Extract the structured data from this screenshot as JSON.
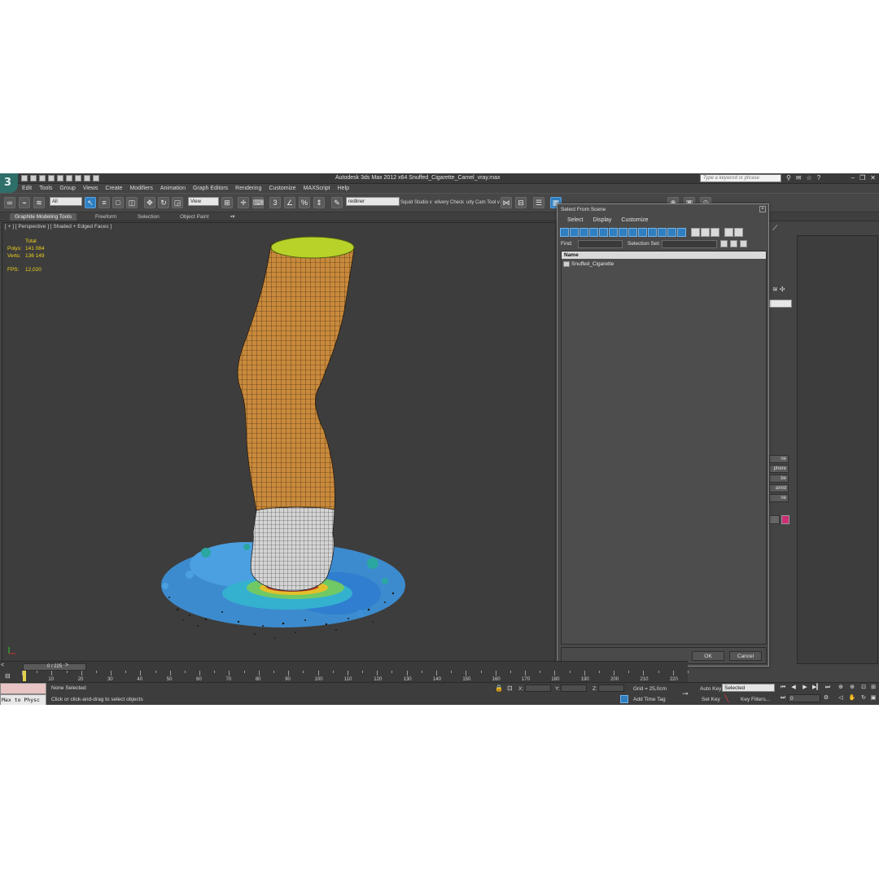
{
  "window": {
    "title": "Autodesk 3ds Max  2012 x64      Snuffed_Cigarette_Camel_vray.max",
    "search_placeholder": "Type a keyword or phrase"
  },
  "menu": [
    "Edit",
    "Tools",
    "Group",
    "Views",
    "Create",
    "Modifiers",
    "Animation",
    "Graph Editors",
    "Rendering",
    "Customize",
    "MAXScript",
    "Help"
  ],
  "toolbar": {
    "filter_value": "All",
    "view_value": "View",
    "named_selection_value": "redliner",
    "extra_labels": [
      "Squid Studio v",
      "elivery Check",
      "uity Cam Tool v"
    ]
  },
  "ribbon": {
    "tabs": [
      "Graphite Modeling Tools",
      "Freeform",
      "Selection",
      "Object Paint"
    ]
  },
  "viewport": {
    "label": "[ + ] [ Perspective ] [ Shaded + Edged Faces ]",
    "stats": {
      "total_label": "Total",
      "polys_label": "Polys:",
      "polys_value": "141 084",
      "verts_label": "Verts:",
      "verts_value": "136 149",
      "fps_label": "FPS:",
      "fps_value": "12,020"
    }
  },
  "command_panel": {
    "buttons": [
      "ne",
      "phere",
      "be",
      "amid",
      "ne"
    ],
    "swatch_color": "#cc2f72"
  },
  "dialog": {
    "title": "Select From Scene",
    "menu": [
      "Select",
      "Display",
      "Customize"
    ],
    "find_label": "Find:",
    "selection_set_label": "Selection Set:",
    "column_name": "Name",
    "items": [
      "Snuffed_Cigarette"
    ],
    "ok_label": "OK",
    "cancel_label": "Cancel"
  },
  "timeline": {
    "slider_text": "0 / 225",
    "ticks": [
      "10",
      "20",
      "30",
      "40",
      "50",
      "60",
      "70",
      "80",
      "90",
      "100",
      "110",
      "120",
      "130",
      "140",
      "150",
      "160",
      "170",
      "180",
      "190",
      "200",
      "210",
      "220"
    ]
  },
  "status": {
    "max_to_physc": "Max to Physc",
    "selection_status": "None Selected",
    "prompt": "Click or click-and-drag to select objects",
    "x_label": "X:",
    "y_label": "Y:",
    "z_label": "Z:",
    "grid": "Grid = 25,0cm",
    "add_time_tag": "Add Time Tag",
    "auto_key": "Auto Key",
    "selected_value": "Selected",
    "set_key": "Set Key",
    "key_filters": "Key Filters...",
    "frame_value": "0"
  },
  "colors": {
    "accent": "#2f7fc1",
    "stats_text": "#f2d21a",
    "filter_tip": "#b8d22a",
    "tobacco": "#c98a3c"
  }
}
